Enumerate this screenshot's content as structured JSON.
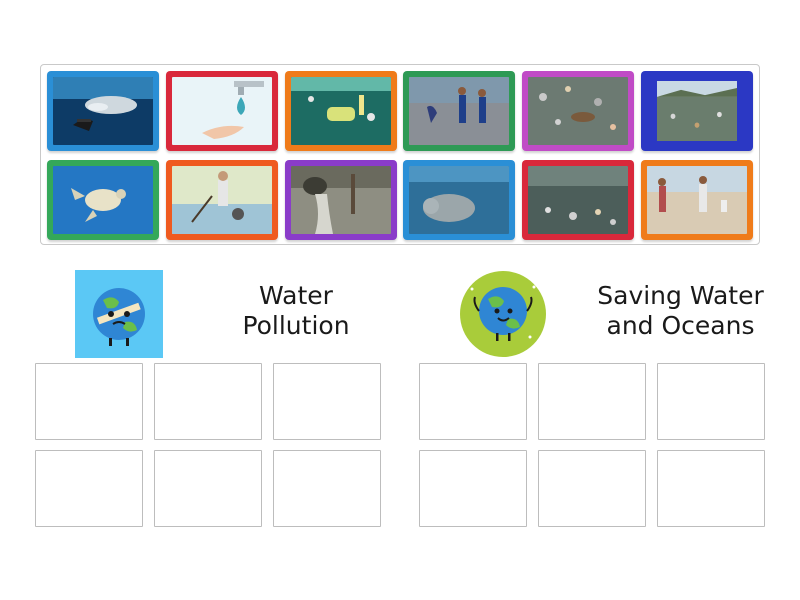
{
  "tray": {
    "tiles": [
      {
        "name": "whale-underwater",
        "frame": "#2a8fd6"
      },
      {
        "name": "hand-water-drop-faucet",
        "frame": "#d9283b"
      },
      {
        "name": "plastic-bottle-underwater",
        "frame": "#ef7b1a"
      },
      {
        "name": "beach-cleanup-volunteers",
        "frame": "#2e9a55"
      },
      {
        "name": "garbage-floating-water",
        "frame": "#c04bc6"
      },
      {
        "name": "trash-polluted-shore",
        "frame": "#2b38c4"
      },
      {
        "name": "turtle-swimming",
        "frame": "#34a85a"
      },
      {
        "name": "person-fishing-trash",
        "frame": "#ef5a1f"
      },
      {
        "name": "sewage-pipe-discharge",
        "frame": "#8a3cc9"
      },
      {
        "name": "manatee-underwater",
        "frame": "#2a8fd6"
      },
      {
        "name": "trash-in-water",
        "frame": "#d9283b"
      },
      {
        "name": "people-collecting-beach-trash",
        "frame": "#ef7b1a"
      }
    ]
  },
  "groups": [
    {
      "title_line1": "Water",
      "title_line2": "Pollution",
      "icon": "sad-earth-bandage-icon",
      "icon_bg": "#5bc8f5"
    },
    {
      "title_line1": "Saving Water",
      "title_line2": "and Oceans",
      "icon": "happy-earth-icon",
      "icon_bg": "#a9cc3a"
    }
  ]
}
